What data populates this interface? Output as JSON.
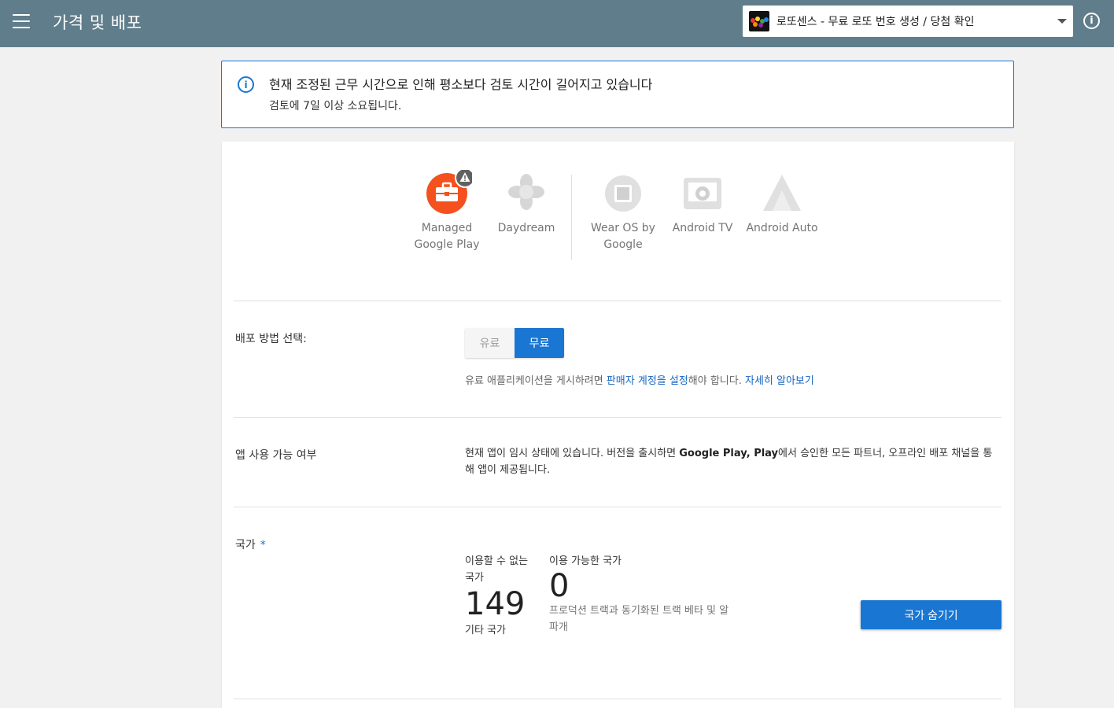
{
  "header": {
    "title": "가격 및 배포",
    "app_name": "로또센스 - 무료 로또 번호 생성 / 당첨 확인",
    "info_glyph": "i"
  },
  "notice": {
    "icon_glyph": "i",
    "title": "현재 조정된 근무 시간으로 인해 평소보다 검토 시간이 길어지고 있습니다",
    "body": "검토에 7일 이상 소요됩니다."
  },
  "devices": [
    {
      "label": "Managed Google Play",
      "icon": "briefcase-icon"
    },
    {
      "label": "Daydream",
      "icon": "daydream-icon"
    },
    {
      "label": "Wear OS by Google",
      "icon": "watch-icon"
    },
    {
      "label": "Android TV",
      "icon": "tv-icon"
    },
    {
      "label": "Android Auto",
      "icon": "auto-icon"
    }
  ],
  "distribution": {
    "label": "배포 방법 선택:",
    "paid": "유료",
    "free": "무료",
    "hint_prefix": "유료 애플리케이션을 게시하려면 ",
    "hint_link": "판매자 계정을 설정",
    "hint_suffix": "해야 합니다. ",
    "learn_more": "자세히 알아보기"
  },
  "availability": {
    "label": "앱 사용 가능 여부",
    "text_1": "현재 앱이 임시 상태에 있습니다. 버전을 출시하면 ",
    "text_bold": "Google Play, Play",
    "text_2": "에서 승인한 모든 파트너, 오프라인 배포 채널을 통해 앱이 제공됩니다."
  },
  "countries": {
    "label": "국가",
    "required_mark": "*",
    "unavailable_label": "이용할 수 없는 국가",
    "unavailable_count": "149",
    "unavailable_sub": "기타 국가",
    "available_label": "이용 가능한 국가",
    "available_count": "0",
    "available_sub": "프로덕션 트랙과 동기화된 트랙 베타 및 알파개",
    "hide_button": "국가 숨기기"
  },
  "colors": {
    "header": "#607d8b",
    "accent": "#1976d2",
    "managed_play": "#f4511e"
  }
}
